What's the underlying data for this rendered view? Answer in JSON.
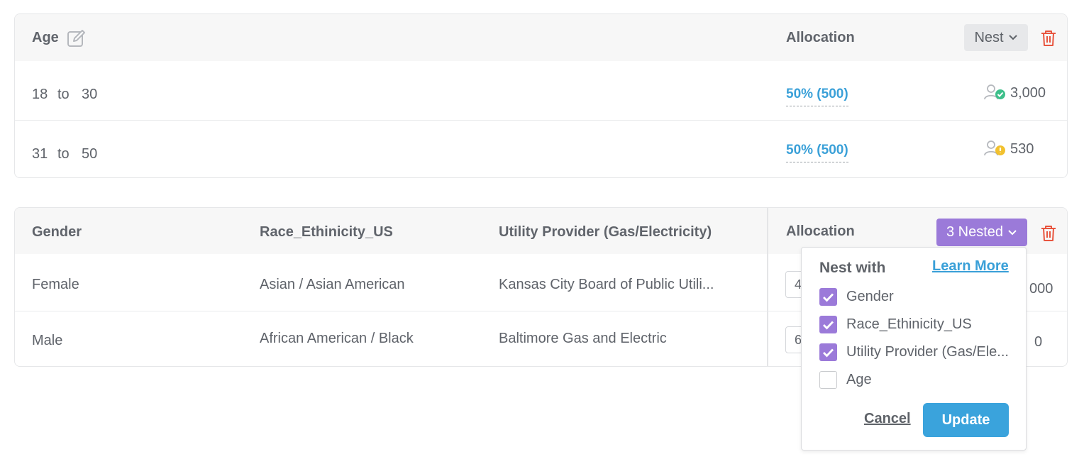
{
  "quota1": {
    "title": "Age",
    "allocation_header": "Allocation",
    "nest_button": "Nest",
    "rows": [
      {
        "from": "18",
        "sep": "to",
        "to": "30",
        "allocation": "50% (500)",
        "available": "3,000",
        "status": "ok"
      },
      {
        "from": "31",
        "sep": "to",
        "to": "50",
        "allocation": "50% (500)",
        "available": "530",
        "status": "warning"
      }
    ]
  },
  "quota2": {
    "columns": [
      "Gender",
      "Race_Ethinicity_US",
      "Utility Provider (Gas/Electricity)"
    ],
    "allocation_header": "Allocation",
    "nested_button": "3 Nested",
    "rows": [
      {
        "cells": [
          "Female",
          "Asian / Asian American",
          "Kansas City Board of Public Utili..."
        ],
        "input_value": "4",
        "available": "000"
      },
      {
        "cells": [
          "Male",
          "African American / Black",
          "Baltimore Gas and Electric"
        ],
        "input_value": "6",
        "available": "0"
      }
    ]
  },
  "nest_popup": {
    "title": "Nest with",
    "learn_more": "Learn More",
    "options": [
      {
        "label": "Gender",
        "checked": true
      },
      {
        "label": "Race_Ethinicity_US",
        "checked": true
      },
      {
        "label": "Utility Provider (Gas/Ele...",
        "checked": true
      },
      {
        "label": "Age",
        "checked": false
      }
    ],
    "cancel": "Cancel",
    "update": "Update"
  },
  "colors": {
    "accent_purple": "#9b7ad9",
    "accent_blue": "#3aa3dc",
    "delete_red": "#e8553f",
    "ok_green": "#3dbf8a",
    "warn_yellow": "#f2c12e"
  },
  "icons": [
    "edit-icon",
    "chevron-down-icon",
    "trash-icon",
    "user-check-icon",
    "user-warning-icon",
    "checkmark-icon"
  ]
}
